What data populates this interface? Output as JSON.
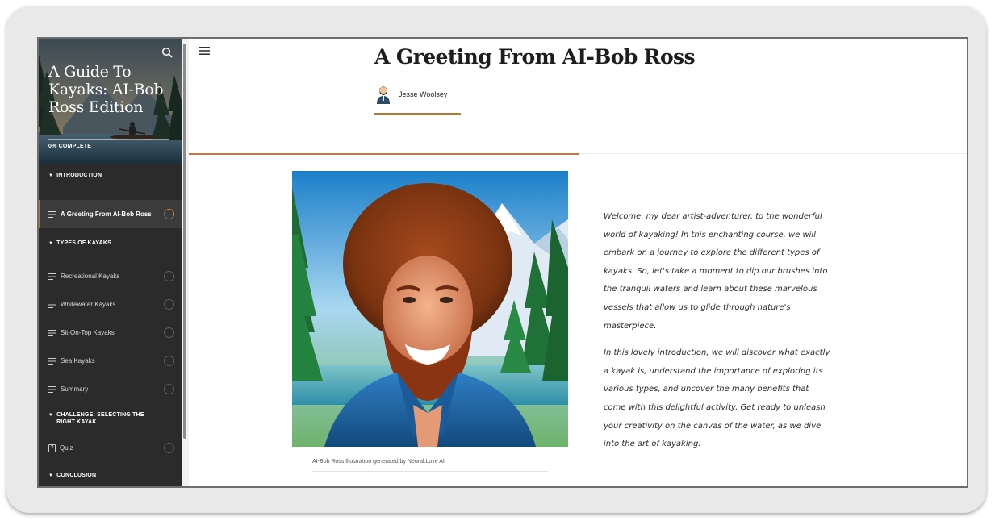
{
  "sidebar": {
    "course_title": "A Guide To Kayaks: AI-Bob Ross Edition",
    "progress_text": "0% COMPLETE",
    "progress_value": 0,
    "sections": [
      {
        "title": "INTRODUCTION",
        "lessons": [
          {
            "label": "A Greeting From AI-Bob Ross",
            "icon": "lines-icon",
            "status": "in-progress",
            "active": true
          }
        ]
      },
      {
        "title": "TYPES OF KAYAKS",
        "lessons": [
          {
            "label": "Recreational Kayaks",
            "icon": "lines-icon",
            "status": "not-started"
          },
          {
            "label": "Whitewater Kayaks",
            "icon": "lines-icon",
            "status": "not-started"
          },
          {
            "label": "Sit-On-Top Kayaks",
            "icon": "lines-icon",
            "status": "not-started"
          },
          {
            "label": "Sea Kayaks",
            "icon": "lines-icon",
            "status": "not-started"
          },
          {
            "label": "Summary",
            "icon": "lines-icon",
            "status": "not-started"
          }
        ]
      },
      {
        "title": "CHALLENGE: SELECTING THE RIGHT KAYAK",
        "lessons": [
          {
            "label": "Quiz",
            "icon": "quiz-icon",
            "status": "not-started"
          }
        ]
      },
      {
        "title": "CONCLUSION",
        "lessons": []
      }
    ]
  },
  "lesson": {
    "title": "A Greeting From AI-Bob Ross",
    "author": "Jesse Woolsey",
    "image_alt": "AI-Bob Ross portrait",
    "caption": "AI-Bob Ross Illustration generated by Neural.Love AI",
    "paragraphs": [
      "Welcome, my dear artist-adventurer, to the wonderful world of kayaking! In this enchanting course, we will embark on a journey to explore the different types of kayaks. So, let's take a moment to dip our brushes into the tranquil waters and learn about these marvelous vessels that allow us to glide through nature's masterpiece.",
      "In this lovely introduction, we will discover what exactly a kayak is, understand the importance of exploring its various types, and uncover the many benefits that come with this delightful activity. Get ready to unleash your creativity on the canvas of the water, as we dive into the art of kayaking."
    ]
  },
  "colors": {
    "accent": "#a87a43",
    "sidebar_bg": "#2b2b2b",
    "header_progress": "#b87a4a"
  }
}
